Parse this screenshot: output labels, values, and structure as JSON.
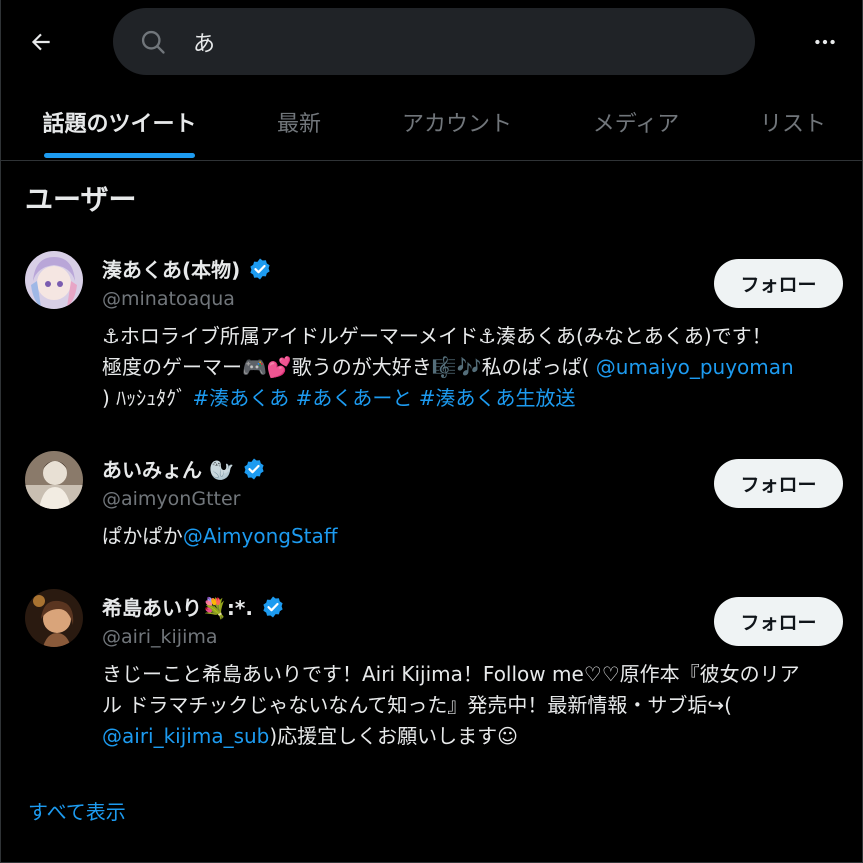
{
  "search": {
    "query": "あ"
  },
  "tabs": [
    {
      "label": "話題のツイート"
    },
    {
      "label": "最新"
    },
    {
      "label": "アカウント"
    },
    {
      "label": "メディア"
    },
    {
      "label": "リスト"
    }
  ],
  "section": {
    "title": "ユーザー"
  },
  "users": [
    {
      "name": "湊あくあ(本物)",
      "handle": "@minatoaqua",
      "follow_label": "フォロー",
      "bio": {
        "line1": "⚓ホロライブ所属アイドルゲーマーメイド⚓湊あくあ(みなとあくあ)です！",
        "line2_text": "極度のゲーマー🎮💕歌うのが大好き🎼🎶私のぱっぱ( ",
        "line2_link": "@umaiyo_puyoman",
        "line3_text": ") ﾊｯｼｭﾀｸﾞ ",
        "line3_link": "#湊あくあ #あくあーと #湊あくあ生放送"
      }
    },
    {
      "name": "あいみょん 🦭",
      "handle": "@aimyonGtter",
      "follow_label": "フォロー",
      "bio": {
        "text": "ぱかぱか",
        "link": "@AimyongStaff"
      }
    },
    {
      "name": "希島あいり💐:*.",
      "handle": "@airi_kijima",
      "follow_label": "フォロー",
      "bio": {
        "line1": "きじーこと希島あいりです！Airi Kijima！Follow me♡♡原作本『彼女のリア",
        "line2": "ル ドラマチックじゃないなんて知った』発売中！最新情報・サブ垢↪(",
        "line3_link": "@airi_kijima_sub",
        "line3_text": ")応援宜しくお願いします☺"
      }
    }
  ],
  "show_all_label": "すべて表示",
  "colors": {
    "accent": "#1d9bf0",
    "background": "#000000",
    "muted": "#71767b"
  },
  "icons": [
    "back-arrow-icon",
    "search-icon",
    "more-icon",
    "verified-icon"
  ]
}
